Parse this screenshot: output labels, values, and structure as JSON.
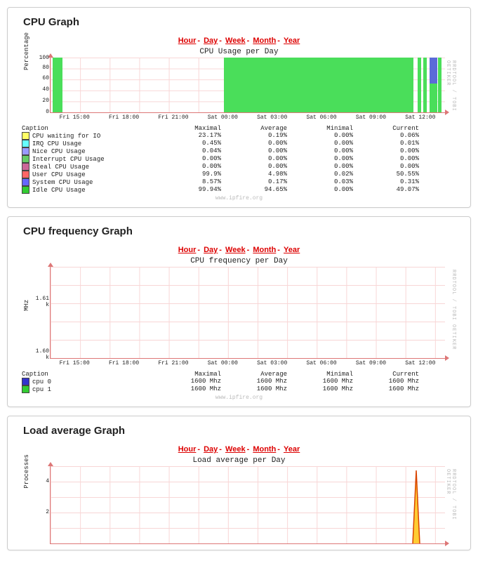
{
  "time_nav": [
    "Hour",
    "Day",
    "Week",
    "Month",
    "Year"
  ],
  "footer": "www.ipfire.org",
  "side_label": "RRDTOOL / TOBI OETIKER",
  "panels": {
    "cpu": {
      "heading": "CPU Graph",
      "title": "CPU Usage per Day",
      "ylabel": "Percentage",
      "yticks": [
        "0",
        "20",
        "40",
        "60",
        "80",
        "100"
      ],
      "xticks": [
        "Fri 15:00",
        "Fri 18:00",
        "Fri 21:00",
        "Sat 00:00",
        "Sat 03:00",
        "Sat 06:00",
        "Sat 09:00",
        "Sat 12:00"
      ],
      "legend_cols": [
        "Caption",
        "Maximal",
        "Average",
        "Minimal",
        "Current"
      ],
      "rows": [
        {
          "color": "#ffff66",
          "label": "CPU waiting for IO",
          "max": "23.17%",
          "avg": "0.19%",
          "min": "0.00%",
          "cur": "0.06%"
        },
        {
          "color": "#66ffff",
          "label": "IRQ CPU Usage",
          "max": "0.45%",
          "avg": "0.00%",
          "min": "0.00%",
          "cur": "0.01%"
        },
        {
          "color": "#9999ff",
          "label": "Nice CPU Usage",
          "max": "0.04%",
          "avg": "0.00%",
          "min": "0.00%",
          "cur": "0.00%"
        },
        {
          "color": "#66cc66",
          "label": "Interrupt CPU Usage",
          "max": "0.00%",
          "avg": "0.00%",
          "min": "0.00%",
          "cur": "0.00%"
        },
        {
          "color": "#cc6699",
          "label": "Steal CPU Usage",
          "max": "0.00%",
          "avg": "0.00%",
          "min": "0.00%",
          "cur": "0.00%"
        },
        {
          "color": "#ff6666",
          "label": "User CPU Usage",
          "max": "99.9%",
          "avg": "4.98%",
          "min": "0.02%",
          "cur": "50.55%"
        },
        {
          "color": "#6666ff",
          "label": "System CPU Usage",
          "max": "8.57%",
          "avg": "0.17%",
          "min": "0.03%",
          "cur": "0.31%"
        },
        {
          "color": "#33cc33",
          "label": "Idle CPU Usage",
          "max": "99.94%",
          "avg": "94.65%",
          "min": "0.00%",
          "cur": "49.07%"
        }
      ]
    },
    "freq": {
      "heading": "CPU frequency Graph",
      "title": "CPU frequency per Day",
      "ylabel": "MHz",
      "yticks": [
        "1.60 k",
        "1.61 k"
      ],
      "xticks": [
        "Fri 15:00",
        "Fri 18:00",
        "Fri 21:00",
        "Sat 00:00",
        "Sat 03:00",
        "Sat 06:00",
        "Sat 09:00",
        "Sat 12:00"
      ],
      "legend_cols": [
        "Caption",
        "Maximal",
        "Average",
        "Minimal",
        "Current"
      ],
      "rows": [
        {
          "color": "#3333cc",
          "label": "cpu 0",
          "max": "1600 Mhz",
          "avg": "1600 Mhz",
          "min": "1600 Mhz",
          "cur": "1600 Mhz"
        },
        {
          "color": "#33cc33",
          "label": "cpu 1",
          "max": "1600 Mhz",
          "avg": "1600 Mhz",
          "min": "1600 Mhz",
          "cur": "1600 Mhz"
        }
      ]
    },
    "load": {
      "heading": "Load average Graph",
      "title": "Load average per Day",
      "ylabel": "Processes",
      "yticks": [
        "",
        "2",
        "",
        "4",
        ""
      ]
    }
  },
  "chart_data": [
    {
      "type": "area",
      "title": "CPU Usage per Day",
      "ylabel": "Percentage",
      "ylim": [
        0,
        100
      ],
      "x": [
        "Fri 15:00",
        "Fri 18:00",
        "Fri 21:00",
        "Sat 00:00",
        "Sat 03:00",
        "Sat 06:00",
        "Sat 09:00",
        "Sat 12:00"
      ],
      "series": [
        {
          "name": "Idle CPU Usage",
          "values": [
            100,
            0,
            0,
            100,
            100,
            100,
            100,
            49
          ]
        }
      ],
      "notes": "Nearly 100% idle green fill from ~Sat 00:00 to Sat 12:00; short 100% bar near start; blue/red spike near Sat 12:00"
    },
    {
      "type": "line",
      "title": "CPU frequency per Day",
      "ylabel": "MHz",
      "ylim": [
        1600,
        1610
      ],
      "x": [
        "Fri 15:00",
        "Fri 18:00",
        "Fri 21:00",
        "Sat 00:00",
        "Sat 03:00",
        "Sat 06:00",
        "Sat 09:00",
        "Sat 12:00"
      ],
      "series": [
        {
          "name": "cpu 0",
          "values": [
            1600,
            1600,
            1600,
            1600,
            1600,
            1600,
            1600,
            1600
          ]
        },
        {
          "name": "cpu 1",
          "values": [
            1600,
            1600,
            1600,
            1600,
            1600,
            1600,
            1600,
            1600
          ]
        }
      ]
    },
    {
      "type": "line",
      "title": "Load average per Day",
      "ylabel": "Processes",
      "ylim": [
        0,
        5
      ],
      "notes": "Flat near 0 with single spike to ~5 near Sat 12:00"
    }
  ]
}
